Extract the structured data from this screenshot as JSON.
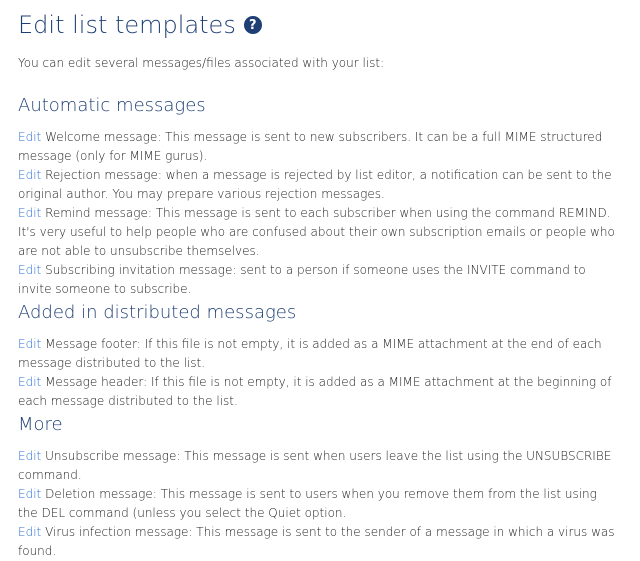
{
  "header": {
    "title": "Edit list templates",
    "help_icon": "question-circle-icon"
  },
  "intro": "You can edit several messages/files associated with your list:",
  "edit_label": "Edit",
  "sections": [
    {
      "title": "Automatic messages",
      "items": [
        "Welcome message: This message is sent to new subscribers. It can be a full MIME structured message (only for MIME gurus).",
        "Rejection message: when a message is rejected by list editor, a notification can be sent to the original author. You may prepare various rejection messages.",
        "Remind message: This message is sent to each subscriber when using the command REMIND. It's very useful to help people who are confused about their own subscription emails or people who are not able to unsubscribe themselves.",
        "Subscribing invitation message: sent to a person if someone uses the INVITE command to invite someone to subscribe."
      ]
    },
    {
      "title": "Added in distributed messages",
      "items": [
        "Message footer: If this file is not empty, it is added as a MIME attachment at the end of each message distributed to the list.",
        "Message header: If this file is not empty, it is added as a MIME attachment at the beginning of each message distributed to the list."
      ]
    },
    {
      "title": "More",
      "items": [
        "Unsubscribe message: This message is sent when users leave the list using the UNSUBSCRIBE command.",
        "Deletion message: This message is sent to users when you remove them from the list using the DEL command (unless you select the Quiet option.",
        "Virus infection message: This message is sent to the sender of a message in which a virus was found."
      ]
    }
  ],
  "colors": {
    "heading": "#1f3f74",
    "link": "#2a6fd6",
    "text": "#222222"
  }
}
